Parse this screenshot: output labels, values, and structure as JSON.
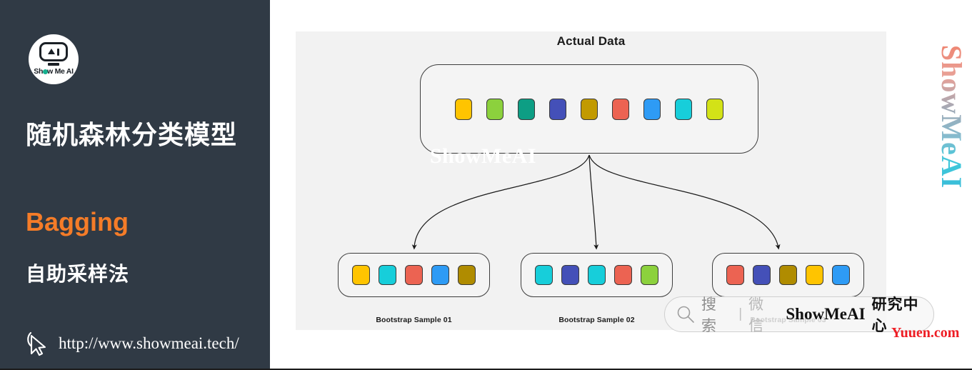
{
  "sidebar": {
    "logo": {
      "icon": "showmeai-robot-logo",
      "text_pre": "Sh",
      "text_dot": "o",
      "text_post": "w Me AI"
    },
    "title": "随机森林分类模型",
    "accent_text": "Bagging",
    "accent_color": "#f57c28",
    "subtitle": "自助采样法",
    "url": "http://www.showmeai.tech/",
    "cursor_icon": "cursor-pointer-icon",
    "background_color": "#303a45"
  },
  "diagram": {
    "title": "Actual Data",
    "watermark": "ShowMeAI",
    "panel_color": "#f2f2f2",
    "actual_data": {
      "chips": [
        {
          "color": "#ffc400",
          "name": "gold"
        },
        {
          "color": "#8cd13d",
          "name": "lime-green"
        },
        {
          "color": "#0d9e84",
          "name": "teal"
        },
        {
          "color": "#4450b8",
          "name": "indigo"
        },
        {
          "color": "#c29a00",
          "name": "dark-gold"
        },
        {
          "color": "#ec6352",
          "name": "coral-red"
        },
        {
          "color": "#2e9bf5",
          "name": "dodger-blue"
        },
        {
          "color": "#17ceda",
          "name": "cyan"
        },
        {
          "color": "#d3e217",
          "name": "yellow-green"
        }
      ]
    },
    "samples": [
      {
        "label": "Bootstrap Sample 01",
        "chips": [
          {
            "color": "#ffc400",
            "name": "gold"
          },
          {
            "color": "#17ceda",
            "name": "cyan"
          },
          {
            "color": "#ec6352",
            "name": "coral-red"
          },
          {
            "color": "#2e9bf5",
            "name": "dodger-blue"
          },
          {
            "color": "#b08c00",
            "name": "dark-gold"
          }
        ]
      },
      {
        "label": "Bootstrap Sample 02",
        "chips": [
          {
            "color": "#17ceda",
            "name": "cyan"
          },
          {
            "color": "#4450b8",
            "name": "indigo"
          },
          {
            "color": "#17ceda",
            "name": "cyan"
          },
          {
            "color": "#ec6352",
            "name": "coral-red"
          },
          {
            "color": "#8cd13d",
            "name": "lime-green"
          }
        ]
      },
      {
        "label": "Bootstrap Sample 03",
        "chips": [
          {
            "color": "#ec6352",
            "name": "coral-red"
          },
          {
            "color": "#4450b8",
            "name": "indigo"
          },
          {
            "color": "#b08c00",
            "name": "dark-gold"
          },
          {
            "color": "#ffc400",
            "name": "gold"
          },
          {
            "color": "#2e9bf5",
            "name": "dodger-blue"
          }
        ]
      }
    ]
  },
  "watermarks": {
    "vertical_brand": "ShowMeAI",
    "search_box": {
      "magnifier_icon": "search-icon",
      "search_label": "搜索",
      "divider": "|",
      "wechat_label": "微信",
      "brand": "ShowMeAI",
      "center_label": "研究中心"
    },
    "site_tag": "Yuuen.com"
  }
}
